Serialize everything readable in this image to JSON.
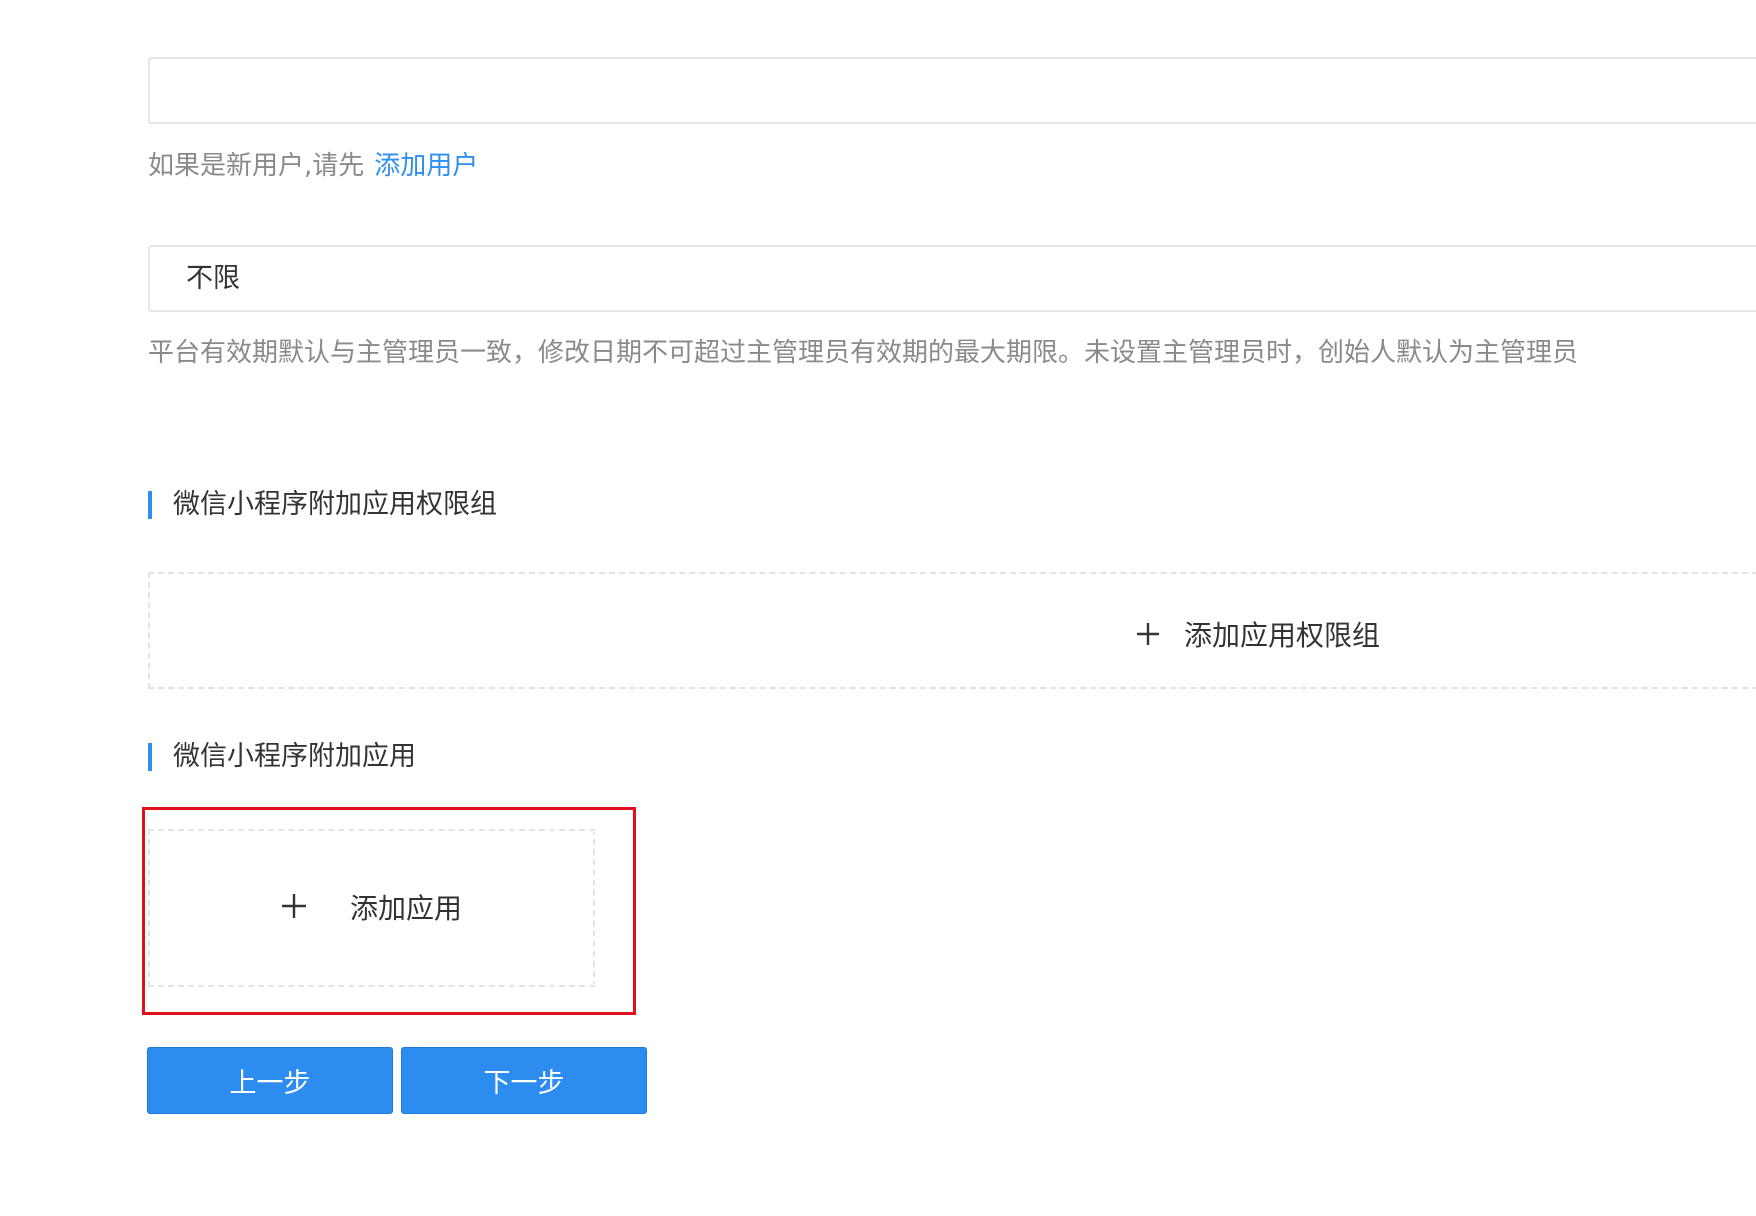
{
  "form": {
    "user_field": {
      "value": "",
      "placeholder": ""
    },
    "user_hint": {
      "text": "如果是新用户,请先",
      "link_label": "添加用户"
    },
    "validity_field": {
      "selected_value": "不限"
    },
    "validity_note": "平台有效期默认与主管理员一致，修改日期不可超过主管理员有效期的最大期限。未设置主管理员时，创始人默认为主管理员"
  },
  "sections": {
    "permission_groups": {
      "title": "微信小程序附加应用权限组",
      "add_label": "添加应用权限组",
      "add_icon": "plus-icon"
    },
    "apps": {
      "title": "微信小程序附加应用",
      "add_label": "添加应用",
      "add_icon": "plus-icon"
    }
  },
  "actions": {
    "prev_label": "上一步",
    "next_label": "下一步"
  },
  "colors": {
    "accent": "#2d8cf0",
    "link": "#2f8ff0",
    "highlight": "#e0111b",
    "muted_text": "#8a8a8a"
  }
}
